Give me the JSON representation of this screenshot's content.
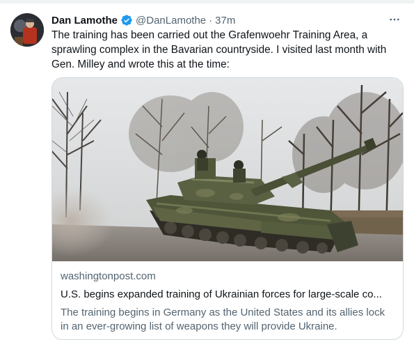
{
  "tweet": {
    "author_name": "Dan Lamothe",
    "handle": "@DanLamothe",
    "separator": "·",
    "time": "37m",
    "text": "The training has been carried out the Grafenwoehr Training Area, a sprawling complex in the Bavarian countryside. I visited last month with Gen. Milley and wrote this at the time:",
    "verified_color": "#1d9bf0",
    "more_icon": "more-horizontal-icon"
  },
  "card": {
    "domain": "washingtonpost.com",
    "title": "U.S. begins expanded training of Ukrainian forces for large-scale co...",
    "description": "The training begins in Germany as the United States and its allies lock in an ever-growing list of weapons they will provide Ukraine."
  }
}
